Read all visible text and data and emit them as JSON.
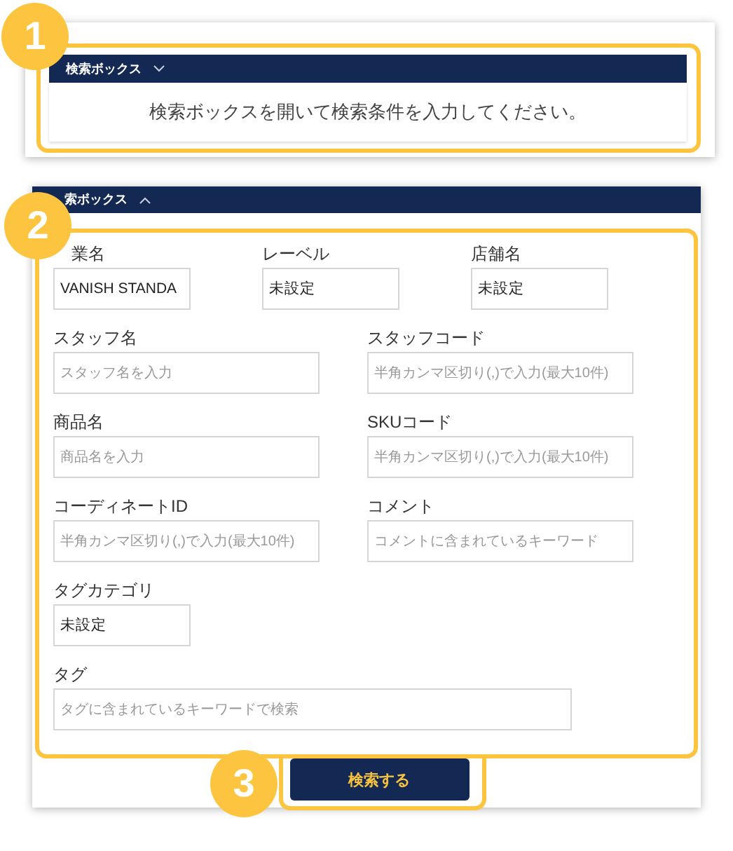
{
  "collapsed_box": {
    "title": "検索ボックス",
    "expanded": false,
    "message": "検索ボックスを開いて検索条件を入力してください。"
  },
  "expanded_box": {
    "title": "索ボックス",
    "expanded": true,
    "rows": [
      {
        "kind": "thirds",
        "fields": [
          {
            "kind": "short",
            "label": "業名",
            "value": "VANISH STANDA"
          },
          {
            "kind": "short",
            "label": "レーベル",
            "value": "未設定"
          },
          {
            "kind": "short",
            "label": "店舗名",
            "value": "未設定"
          }
        ]
      },
      {
        "kind": "halves",
        "fields": [
          {
            "kind": "medium",
            "label": "スタッフ名",
            "placeholder": "スタッフ名を入力"
          },
          {
            "kind": "medium",
            "label": "スタッフコード",
            "placeholder": "半角カンマ区切り(,)で入力(最大10件)"
          }
        ]
      },
      {
        "kind": "halves",
        "fields": [
          {
            "kind": "medium",
            "label": "商品名",
            "placeholder": "商品名を入力"
          },
          {
            "kind": "medium",
            "label": "SKUコード",
            "placeholder": "半角カンマ区切り(,)で入力(最大10件)"
          }
        ]
      },
      {
        "kind": "halves",
        "fields": [
          {
            "kind": "medium",
            "label": "コーディネートID",
            "placeholder": "半角カンマ区切り(,)で入力(最大10件)"
          },
          {
            "kind": "medium",
            "label": "コメント",
            "placeholder": "コメントに含まれているキーワード"
          }
        ]
      },
      {
        "kind": "halves",
        "fields": [
          {
            "kind": "short",
            "label": "タグカテゴリ",
            "value": "未設定"
          }
        ]
      },
      {
        "kind": "halves",
        "fields": [
          {
            "kind": "long",
            "label": "タグ",
            "placeholder": "タグに含まれているキーワードで検索"
          }
        ]
      }
    ],
    "button": "検索する"
  },
  "callouts": [
    "1",
    "2",
    "3"
  ]
}
